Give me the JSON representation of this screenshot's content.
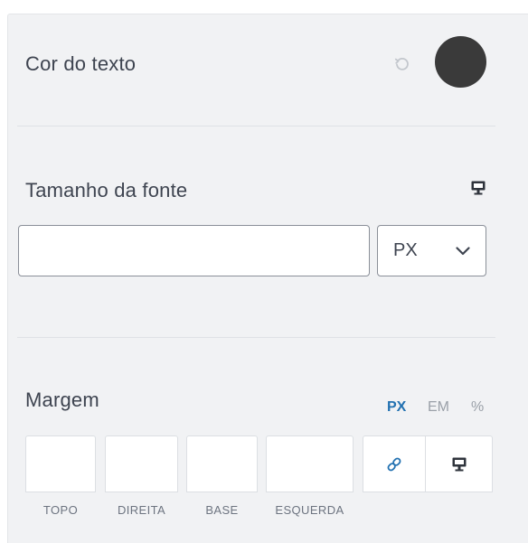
{
  "text_color": {
    "label": "Cor do texto",
    "reset_icon": "reset-icon",
    "value": "#3a3a3a"
  },
  "font_size": {
    "label": "Tamanho da fonte",
    "device_icon": "desktop-icon",
    "value": "",
    "unit": "PX"
  },
  "margin": {
    "label": "Margem",
    "units": [
      "PX",
      "EM",
      "%"
    ],
    "active_unit": "PX",
    "fields": [
      "TOPO",
      "DIREITA",
      "BASE",
      "ESQUERDA"
    ],
    "link_icon": "link-icon",
    "device_icon": "desktop-icon"
  }
}
